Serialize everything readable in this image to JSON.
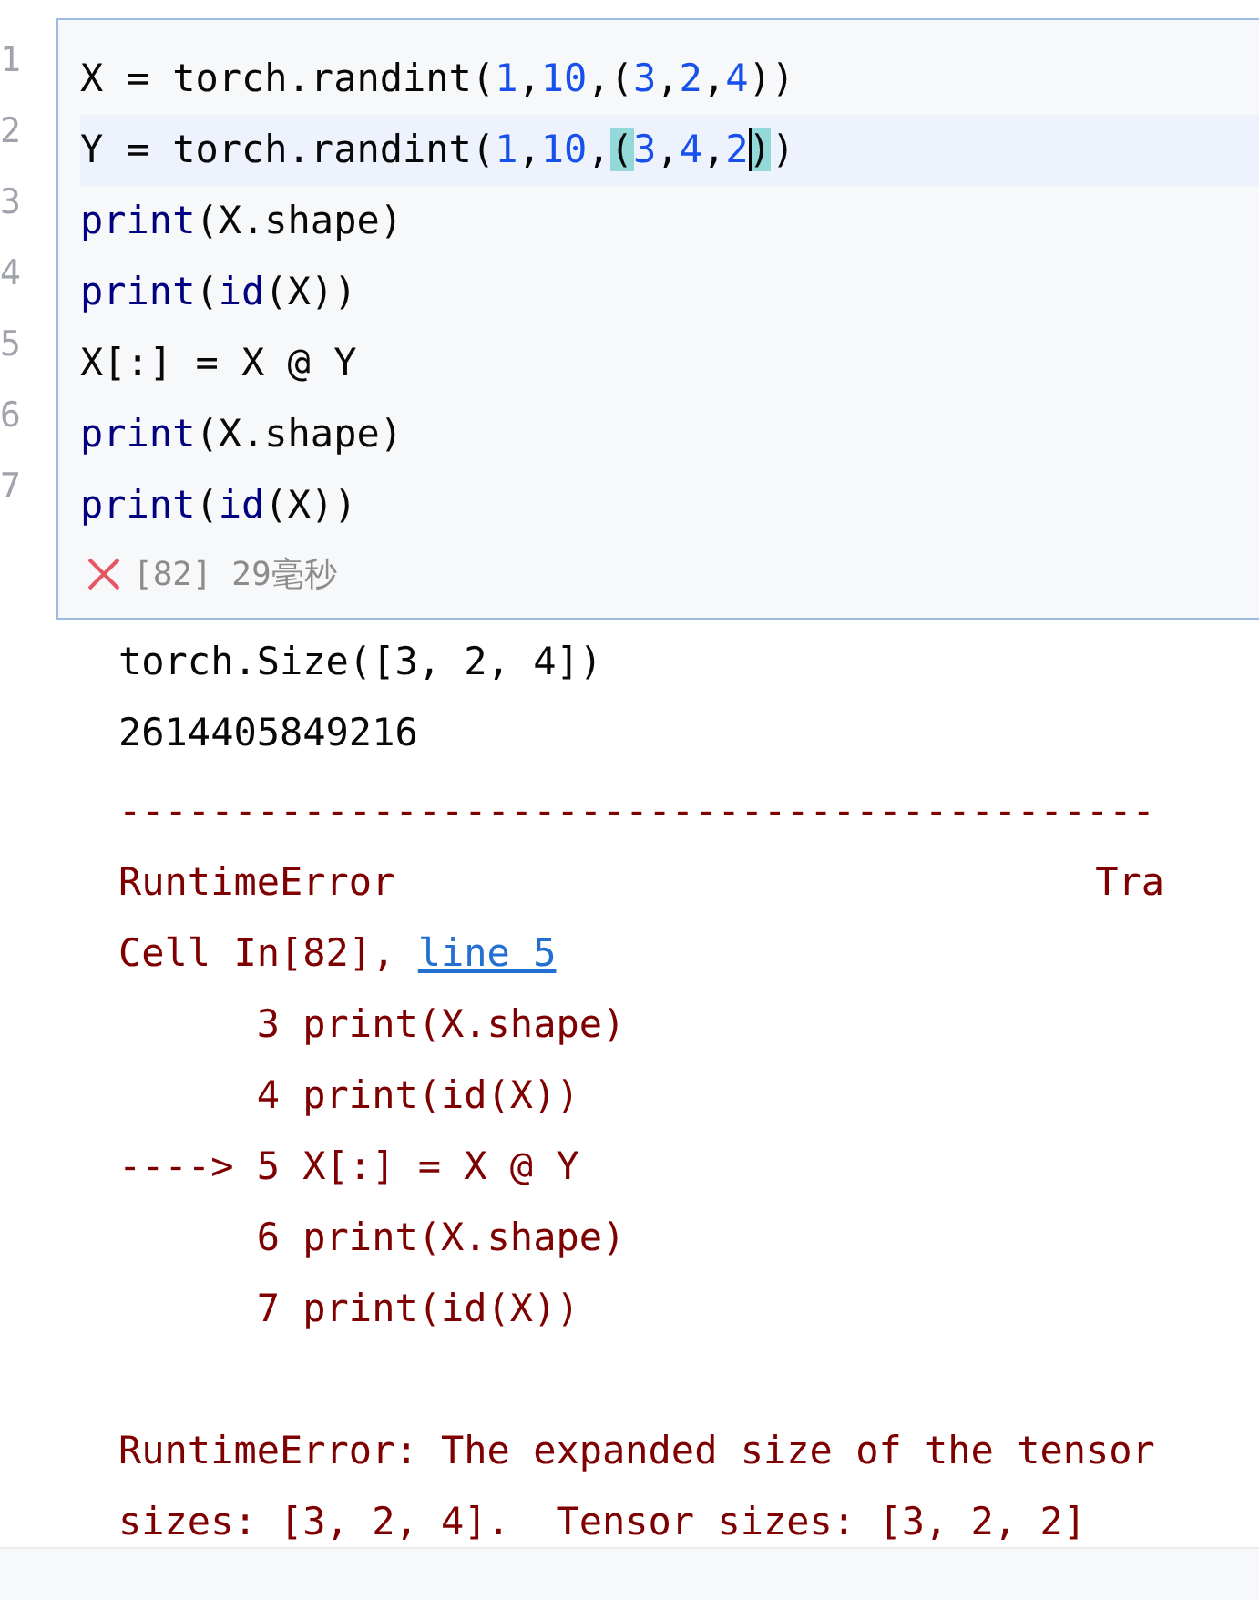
{
  "cell": {
    "lines": [
      {
        "number": "1",
        "current": false,
        "tokens": [
          {
            "text": "X = torch.randint(",
            "kind": "plain"
          },
          {
            "text": "1",
            "kind": "number"
          },
          {
            "text": ",",
            "kind": "plain"
          },
          {
            "text": "10",
            "kind": "number"
          },
          {
            "text": ",(",
            "kind": "plain"
          },
          {
            "text": "3",
            "kind": "number"
          },
          {
            "text": ",",
            "kind": "plain"
          },
          {
            "text": "2",
            "kind": "number"
          },
          {
            "text": ",",
            "kind": "plain"
          },
          {
            "text": "4",
            "kind": "number"
          },
          {
            "text": "))",
            "kind": "plain"
          }
        ]
      },
      {
        "number": "2",
        "current": true,
        "tokens": [
          {
            "text": "Y = torch.randint(",
            "kind": "plain"
          },
          {
            "text": "1",
            "kind": "number"
          },
          {
            "text": ",",
            "kind": "plain"
          },
          {
            "text": "10",
            "kind": "number"
          },
          {
            "text": ",",
            "kind": "plain"
          },
          {
            "text": "(",
            "kind": "match"
          },
          {
            "text": "3",
            "kind": "number"
          },
          {
            "text": ",",
            "kind": "plain"
          },
          {
            "text": "4",
            "kind": "number"
          },
          {
            "text": ",",
            "kind": "plain"
          },
          {
            "text": "2",
            "kind": "number"
          },
          {
            "text": ")",
            "kind": "match_caret"
          },
          {
            "text": ")",
            "kind": "plain"
          }
        ]
      },
      {
        "number": "3",
        "current": false,
        "tokens": [
          {
            "text": "print",
            "kind": "builtin"
          },
          {
            "text": "(X.shape)",
            "kind": "plain"
          }
        ]
      },
      {
        "number": "4",
        "current": false,
        "tokens": [
          {
            "text": "print",
            "kind": "builtin"
          },
          {
            "text": "(",
            "kind": "plain"
          },
          {
            "text": "id",
            "kind": "builtin"
          },
          {
            "text": "(X))",
            "kind": "plain"
          }
        ]
      },
      {
        "number": "5",
        "current": false,
        "tokens": [
          {
            "text": "X[:] = X @ Y",
            "kind": "plain"
          }
        ]
      },
      {
        "number": "6",
        "current": false,
        "tokens": [
          {
            "text": "print",
            "kind": "builtin"
          },
          {
            "text": "(X.shape)",
            "kind": "plain"
          }
        ]
      },
      {
        "number": "7",
        "current": false,
        "tokens": [
          {
            "text": "print",
            "kind": "builtin"
          },
          {
            "text": "(",
            "kind": "plain"
          },
          {
            "text": "id",
            "kind": "builtin"
          },
          {
            "text": "(X))",
            "kind": "plain"
          }
        ]
      }
    ],
    "status": {
      "failed": true,
      "text": "[82] 29毫秒"
    }
  },
  "output": [
    {
      "kind": "stdout",
      "text": "torch.Size([3, 2, 4])"
    },
    {
      "kind": "stdout",
      "text": "2614405849216"
    },
    {
      "kind": "rule",
      "text": "---------------------------------------------"
    },
    {
      "kind": "error_header",
      "text": "RuntimeError",
      "trailing": "Tra"
    },
    {
      "kind": "location",
      "text": "Cell In[82], ",
      "link": "line 5"
    },
    {
      "kind": "trace",
      "text": "      3 print(X.shape)"
    },
    {
      "kind": "trace",
      "text": "      4 print(id(X))"
    },
    {
      "kind": "trace",
      "text": "----> 5 X[:] = X @ Y"
    },
    {
      "kind": "trace",
      "text": "      6 print(X.shape)"
    },
    {
      "kind": "trace",
      "text": "      7 print(id(X))"
    },
    {
      "kind": "message",
      "text": "RuntimeError: The expanded size of the tensor"
    },
    {
      "kind": "trace",
      "text": "sizes: [3, 2, 4].  Tensor sizes: [3, 2, 2]"
    }
  ]
}
